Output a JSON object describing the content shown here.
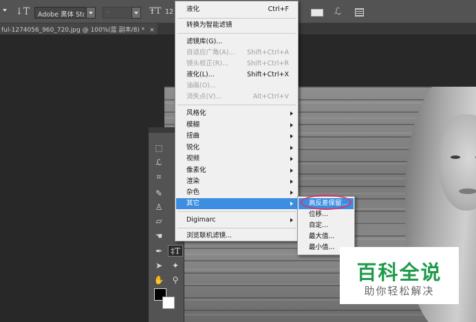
{
  "options_bar": {
    "font_family": "Adobe 黑体 Std",
    "font_style": "-",
    "font_size": "12"
  },
  "document_tab": {
    "title": "ful-1274056_960_720.jpg @ 100%(蓝 副本/8) *",
    "close_symbol": "×"
  },
  "filter_menu": {
    "items": [
      {
        "label": "液化",
        "shortcut": "Ctrl+F",
        "disabled": false
      },
      {
        "label": "转换为智能滤镜",
        "shortcut": "",
        "disabled": false
      },
      {
        "label": "滤镜库(G)...",
        "shortcut": "",
        "disabled": false
      },
      {
        "label": "自适应广角(A)...",
        "shortcut": "Shift+Ctrl+A",
        "disabled": true
      },
      {
        "label": "镜头校正(R)...",
        "shortcut": "Shift+Ctrl+R",
        "disabled": true
      },
      {
        "label": "液化(L)...",
        "shortcut": "Shift+Ctrl+X",
        "disabled": false
      },
      {
        "label": "油画(O)...",
        "shortcut": "",
        "disabled": true
      },
      {
        "label": "消失点(V)...",
        "shortcut": "Alt+Ctrl+V",
        "disabled": true
      },
      {
        "label": "风格化",
        "submenu": true
      },
      {
        "label": "模糊",
        "submenu": true
      },
      {
        "label": "扭曲",
        "submenu": true
      },
      {
        "label": "锐化",
        "submenu": true
      },
      {
        "label": "视频",
        "submenu": true
      },
      {
        "label": "像素化",
        "submenu": true
      },
      {
        "label": "渲染",
        "submenu": true
      },
      {
        "label": "杂色",
        "submenu": true
      },
      {
        "label": "其它",
        "submenu": true,
        "highlighted": true
      },
      {
        "label": "Digimarc",
        "submenu": true
      },
      {
        "label": "浏览联机滤镜...",
        "shortcut": ""
      }
    ]
  },
  "other_submenu": {
    "items": [
      "高反差保留...",
      "位移...",
      "自定...",
      "最大值...",
      "最小值..."
    ],
    "highlighted_index": 0
  },
  "watermark": {
    "title": "百科全说",
    "subtitle": "助你轻松解决"
  },
  "colors": {
    "menu_highlight": "#3d8ee0",
    "annotation_circle": "#d9346e",
    "watermark_green": "#1e9b4a"
  }
}
